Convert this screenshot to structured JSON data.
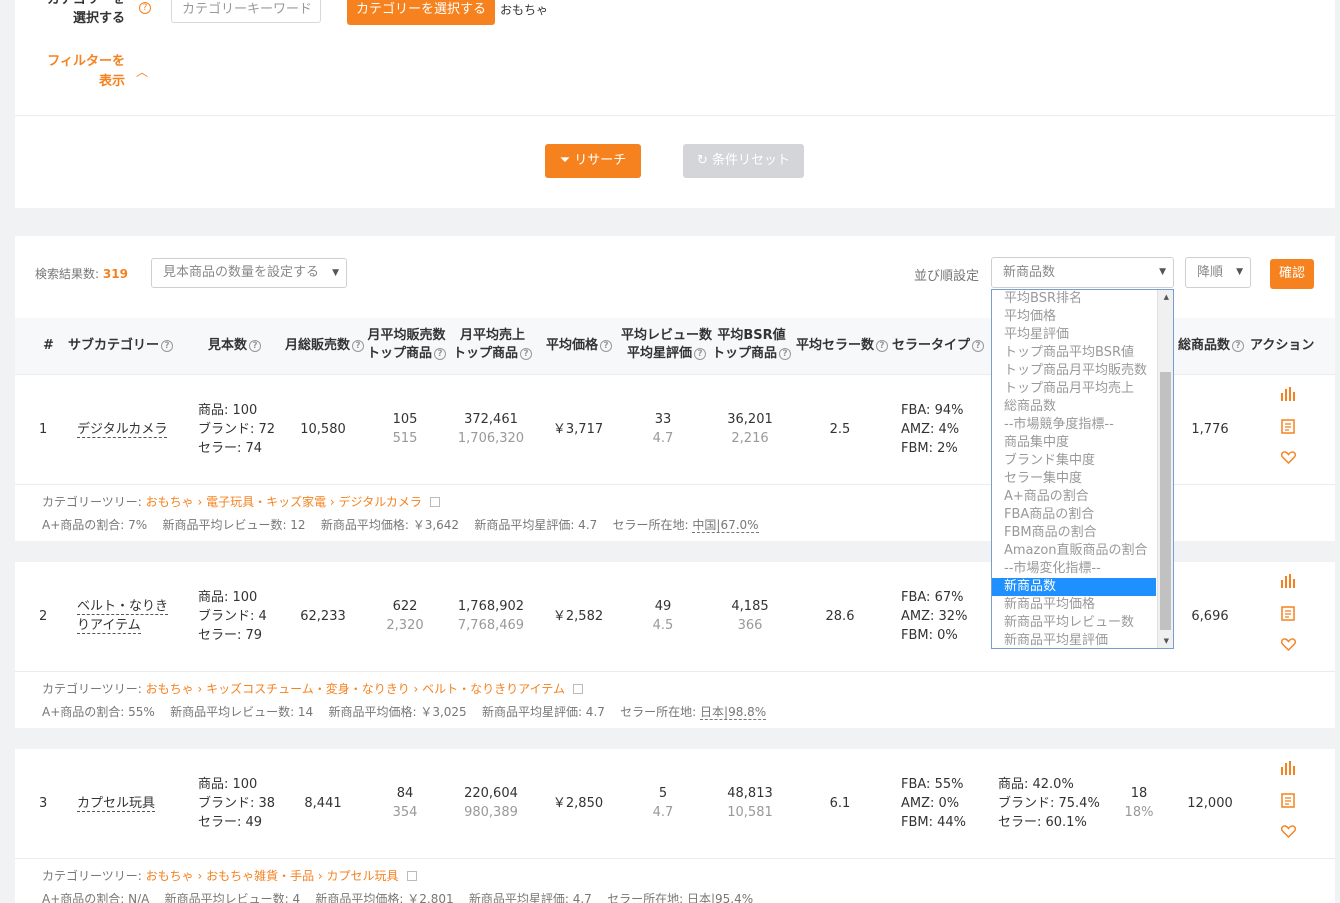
{
  "top": {
    "category_label": "カテゴリーを\n選択する",
    "category_placeholder": "カテゴリーキーワード",
    "category_button": "カテゴリーを選択する",
    "selected_category": "おもちゃ",
    "filter_toggle": "フィルターを\n表示",
    "research_button": "リサーチ",
    "reset_button": "条件リセット"
  },
  "results": {
    "count_label": "検索結果数:",
    "count": "319",
    "sample_select": "見本商品の数量を設定する",
    "sort_label": "並び順設定",
    "sort_select": "新商品数",
    "order_select": "降順",
    "confirm_button": "確認"
  },
  "columns": {
    "num": "#",
    "subcategory": "サブカテゴリー",
    "samples": "見本数",
    "monthly_sales": "月総販売数",
    "avg_monthly_sales": "月平均販売数",
    "top_product_1": "トップ商品",
    "avg_monthly_revenue": "月平均売上",
    "top_product_2": "トップ商品",
    "avg_price": "平均価格",
    "avg_review": "平均レビュー数",
    "avg_star": "平均星評価",
    "avg_bsr": "平均BSR値",
    "top_product_3": "トップ商品",
    "avg_sellers": "平均セラー数",
    "seller_type": "セラータイプ",
    "total_products": "総商品数",
    "action": "アクション"
  },
  "sort_options": [
    "平均BSR排名",
    "平均価格",
    "平均星評価",
    "トップ商品平均BSR値",
    "トップ商品月平均販売数",
    "トップ商品月平均売上",
    "総商品数",
    "--市場競争度指標--",
    "商品集中度",
    "ブランド集中度",
    "セラー集中度",
    "A+商品の割合",
    "FBA商品の割合",
    "FBM商品の割合",
    "Amazon直販商品の割合",
    "--市場変化指標--",
    "新商品数",
    "新商品平均価格",
    "新商品平均レビュー数",
    "新商品平均星評価"
  ],
  "sort_selected_index": 16,
  "rows": [
    {
      "num": "1",
      "name": "デジタルカメラ",
      "samples": [
        "商品: 100",
        "ブランド: 72",
        "セラー: 74"
      ],
      "monthly_sales": "10,580",
      "avg_sales": "105",
      "avg_sales_top": "515",
      "revenue": "372,461",
      "revenue_top": "1,706,320",
      "price": "￥3,717",
      "reviews": "33",
      "stars": "4.7",
      "bsr": "36,201",
      "bsr_top": "2,216",
      "sellers": "2.5",
      "seller_type": [
        "FBA: 94%",
        "AMZ: 4%",
        "FBM: 2%"
      ],
      "concentration": [],
      "new": "",
      "new_pct": "",
      "total": "1,776",
      "tree_label": "カテゴリーツリー:",
      "tree": "おもちゃ › 電子玩具・キッズ家電 › デジタルカメラ",
      "stats": [
        "A+商品の割合: 7%",
        "新商品平均レビュー数: 12",
        "新商品平均価格: ￥3,642",
        "新商品平均星評価: 4.7"
      ],
      "seller_loc_label": "セラー所在地:",
      "seller_loc": "中国|67.0%"
    },
    {
      "num": "2",
      "name": "ベルト・なりきりアイテム",
      "samples": [
        "商品: 100",
        "ブランド: 4",
        "セラー: 79"
      ],
      "monthly_sales": "62,233",
      "avg_sales": "622",
      "avg_sales_top": "2,320",
      "revenue": "1,768,902",
      "revenue_top": "7,768,469",
      "price": "￥2,582",
      "reviews": "49",
      "stars": "4.5",
      "bsr": "4,185",
      "bsr_top": "366",
      "sellers": "28.6",
      "seller_type": [
        "FBA: 67%",
        "AMZ: 32%",
        "FBM: 0%"
      ],
      "concentration": [],
      "new": "",
      "new_pct": "",
      "total": "6,696",
      "tree_label": "カテゴリーツリー:",
      "tree": "おもちゃ › キッズコスチューム・変身・なりきり › ベルト・なりきりアイテム",
      "stats": [
        "A+商品の割合: 55%",
        "新商品平均レビュー数: 14",
        "新商品平均価格: ￥3,025",
        "新商品平均星評価: 4.7"
      ],
      "seller_loc_label": "セラー所在地:",
      "seller_loc": "日本|98.8%"
    },
    {
      "num": "3",
      "name": "カプセル玩具",
      "samples": [
        "商品: 100",
        "ブランド: 38",
        "セラー: 49"
      ],
      "monthly_sales": "8,441",
      "avg_sales": "84",
      "avg_sales_top": "354",
      "revenue": "220,604",
      "revenue_top": "980,389",
      "price": "￥2,850",
      "reviews": "5",
      "stars": "4.7",
      "bsr": "48,813",
      "bsr_top": "10,581",
      "sellers": "6.1",
      "seller_type": [
        "FBA: 55%",
        "AMZ: 0%",
        "FBM: 44%"
      ],
      "concentration": [
        "商品: 42.0%",
        "ブランド: 75.4%",
        "セラー: 60.1%"
      ],
      "new": "18",
      "new_pct": "18%",
      "total": "12,000",
      "tree_label": "カテゴリーツリー:",
      "tree": "おもちゃ › おもちゃ雑貨・手品 › カプセル玩具",
      "stats": [
        "A+商品の割合: N/A",
        "新商品平均レビュー数: 4",
        "新商品平均価格: ￥2,801",
        "新商品平均星評価: 4.7"
      ],
      "seller_loc_label": "セラー所在地:",
      "seller_loc": "日本|95.4%"
    }
  ],
  "colors": {
    "accent": "#f5821f",
    "selected": "#1e90ff",
    "disabled": "#d3d5d8"
  }
}
